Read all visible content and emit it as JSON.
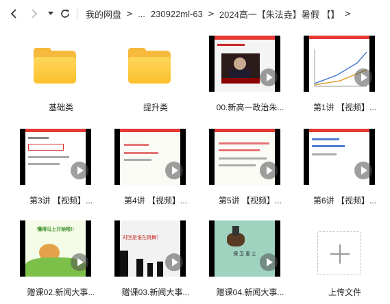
{
  "toolbar": {
    "back_icon": "chevron-left-icon",
    "forward_icon": "chevron-right-icon",
    "history_icon": "caret-down-icon",
    "refresh_icon": "refresh-icon"
  },
  "breadcrumb": {
    "items": [
      "我的网盘",
      "...",
      "230922ml-63",
      "2024高一【朱法垚】暑假 【】"
    ],
    "separator": ">"
  },
  "items": [
    {
      "type": "folder",
      "label": "基础类"
    },
    {
      "type": "folder",
      "label": "提升类"
    },
    {
      "type": "video",
      "label": "00.新高一政治朱..."
    },
    {
      "type": "video",
      "label": "第1讲 【视频】..."
    },
    {
      "type": "video",
      "label": "第3讲 【视频】..."
    },
    {
      "type": "video",
      "label": "第4讲 【视频】..."
    },
    {
      "type": "video",
      "label": "第5讲 【视频】..."
    },
    {
      "type": "video",
      "label": "第6讲 【视频】..."
    },
    {
      "type": "video",
      "label": "赠课02.新闻大事..."
    },
    {
      "type": "video",
      "label": "赠课03.新闻大事..."
    },
    {
      "type": "video",
      "label": "赠课04.新闻大事..."
    },
    {
      "type": "upload",
      "label": "上传文件"
    }
  ],
  "thumb_text": {
    "t9_title": "懂得马上开始啦!!",
    "t10_title": "时回是谁在跳舞？",
    "t11_caption": "保  卫  爱  士"
  },
  "colors": {
    "folder": "#f6b93b",
    "accent_red": "#e53935",
    "play_overlay": "#505050"
  }
}
